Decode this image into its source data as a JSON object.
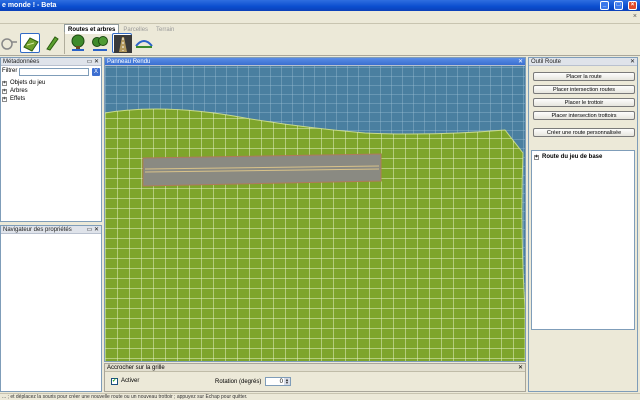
{
  "window": {
    "title": "e monde ! - Beta"
  },
  "toolbar": {
    "tabs": [
      {
        "label": "Routes et arbres",
        "active": true
      },
      {
        "label": "Parcelles",
        "active": false
      },
      {
        "label": "Terrain",
        "active": false
      }
    ],
    "icons": [
      "hand-icon",
      "terrain-paint-icon",
      "brush-icon",
      "tree-icon",
      "tree-cluster-icon",
      "road-icon",
      "bridge-icon"
    ]
  },
  "metadata_panel": {
    "title": "Métadonnées",
    "filter_label": "Filtrer",
    "filter_value": "",
    "clear_label": "X",
    "items": [
      "Objets du jeu",
      "Arbres",
      "Effets"
    ]
  },
  "property_panel": {
    "title": "Navigateur des propriétés"
  },
  "viewport": {
    "title": "Panneau Rendu"
  },
  "snap_bar": {
    "title": "Accrocher sur la grille",
    "activate_label": "Activer",
    "activate_checked": true,
    "rotation_label": "Rotation (degrés)",
    "rotation_value": "0"
  },
  "road_tool": {
    "title": "Outil Route",
    "buttons": [
      "Placer la route",
      "Placer intersection routes",
      "Placer le trottoir",
      "Placer intersection trottoirs",
      "Créer une route personnalisée"
    ],
    "tree_item": "Route du jeu de base"
  },
  "status": {
    "text": "... ; et déplacez la souris pour créer une nouvelle route ou un nouveau trottoir ; appuyez sur Échap pour quitter."
  },
  "colors": {
    "accent": "#316ac5",
    "titlebar": "#0a4ecf",
    "terrain": "#7ea52b",
    "water": "#4a7fa0"
  }
}
